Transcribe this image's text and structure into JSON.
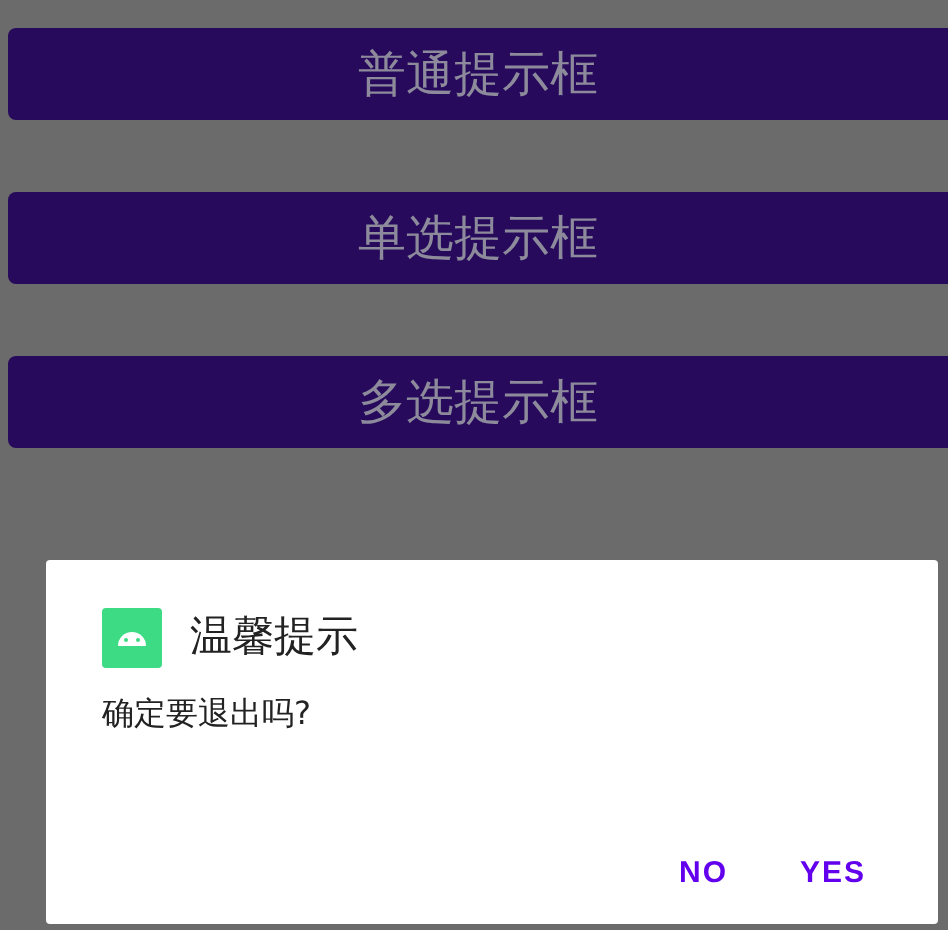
{
  "buttons": [
    "普通提示框",
    "单选提示框",
    "多选提示框"
  ],
  "dialog": {
    "title": "温馨提示",
    "message": "确定要退出吗?",
    "actions": [
      "NO",
      "YES"
    ]
  }
}
